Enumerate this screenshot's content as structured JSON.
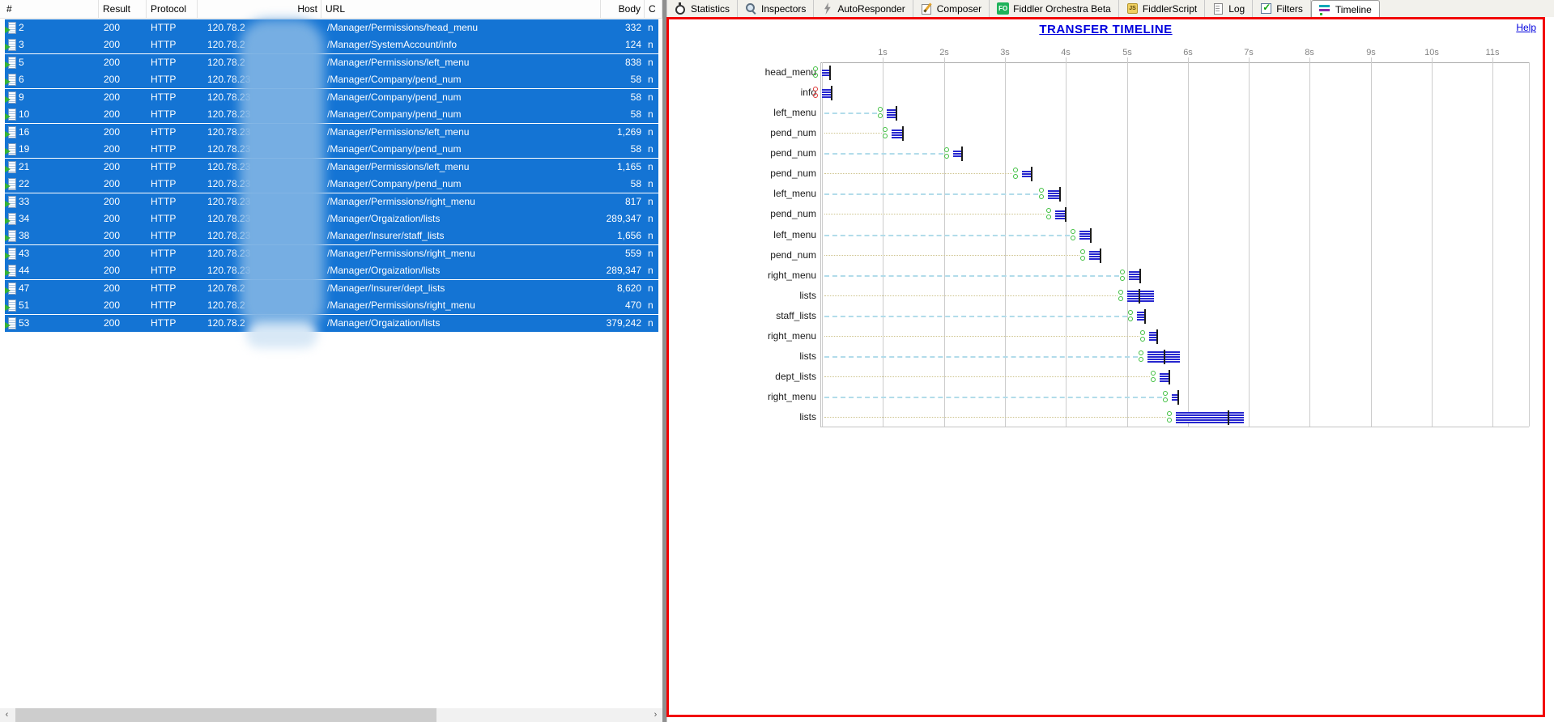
{
  "left_panel": {
    "columns": [
      {
        "label": "#"
      },
      {
        "label": "Result"
      },
      {
        "label": "Protocol"
      },
      {
        "label": "Host"
      },
      {
        "label": "URL"
      },
      {
        "label": "Body"
      },
      {
        "label": "C"
      }
    ],
    "rows": [
      {
        "id": "2",
        "result": "200",
        "protocol": "HTTP",
        "host": "120.78.2",
        "url": "/Manager/Permissions/head_menu",
        "body": "332",
        "caching": "n"
      },
      {
        "id": "3",
        "result": "200",
        "protocol": "HTTP",
        "host": "120.78.2",
        "url": "/Manager/SystemAccount/info",
        "body": "124",
        "caching": "n"
      },
      {
        "id": "5",
        "result": "200",
        "protocol": "HTTP",
        "host": "120.78.2",
        "url": "/Manager/Permissions/left_menu",
        "body": "838",
        "caching": "n"
      },
      {
        "id": "6",
        "result": "200",
        "protocol": "HTTP",
        "host": "120.78.23",
        "url": "/Manager/Company/pend_num",
        "body": "58",
        "caching": "n"
      },
      {
        "id": "9",
        "result": "200",
        "protocol": "HTTP",
        "host": "120.78.23",
        "url": "/Manager/Company/pend_num",
        "body": "58",
        "caching": "n"
      },
      {
        "id": "10",
        "result": "200",
        "protocol": "HTTP",
        "host": "120.78.23",
        "url": "/Manager/Company/pend_num",
        "body": "58",
        "caching": "n"
      },
      {
        "id": "16",
        "result": "200",
        "protocol": "HTTP",
        "host": "120.78.23",
        "url": "/Manager/Permissions/left_menu",
        "body": "1,269",
        "caching": "n"
      },
      {
        "id": "19",
        "result": "200",
        "protocol": "HTTP",
        "host": "120.78.23",
        "url": "/Manager/Company/pend_num",
        "body": "58",
        "caching": "n"
      },
      {
        "id": "21",
        "result": "200",
        "protocol": "HTTP",
        "host": "120.78.23",
        "url": "/Manager/Permissions/left_menu",
        "body": "1,165",
        "caching": "n"
      },
      {
        "id": "22",
        "result": "200",
        "protocol": "HTTP",
        "host": "120.78.23",
        "url": "/Manager/Company/pend_num",
        "body": "58",
        "caching": "n"
      },
      {
        "id": "33",
        "result": "200",
        "protocol": "HTTP",
        "host": "120.78.23",
        "url": "/Manager/Permissions/right_menu",
        "body": "817",
        "caching": "n"
      },
      {
        "id": "34",
        "result": "200",
        "protocol": "HTTP",
        "host": "120.78.23",
        "url": "/Manager/Orgaization/lists",
        "body": "289,347",
        "caching": "n"
      },
      {
        "id": "38",
        "result": "200",
        "protocol": "HTTP",
        "host": "120.78.23",
        "url": "/Manager/Insurer/staff_lists",
        "body": "1,656",
        "caching": "n"
      },
      {
        "id": "43",
        "result": "200",
        "protocol": "HTTP",
        "host": "120.78.23",
        "url": "/Manager/Permissions/right_menu",
        "body": "559",
        "caching": "n"
      },
      {
        "id": "44",
        "result": "200",
        "protocol": "HTTP",
        "host": "120.78.23",
        "url": "/Manager/Orgaization/lists",
        "body": "289,347",
        "caching": "n"
      },
      {
        "id": "47",
        "result": "200",
        "protocol": "HTTP",
        "host": "120.78.2",
        "url": "/Manager/Insurer/dept_lists",
        "body": "8,620",
        "caching": "n"
      },
      {
        "id": "51",
        "result": "200",
        "protocol": "HTTP",
        "host": "120.78.2",
        "url": "/Manager/Permissions/right_menu",
        "body": "470",
        "caching": "n"
      },
      {
        "id": "53",
        "result": "200",
        "protocol": "HTTP",
        "host": "120.78.2",
        "url": "/Manager/Orgaization/lists",
        "body": "379,242",
        "caching": "n"
      }
    ],
    "selection_color": "#1474d4"
  },
  "tabs": [
    {
      "label": "Statistics",
      "icon": "stopwatch-icon",
      "active": false
    },
    {
      "label": "Inspectors",
      "icon": "magnifier-icon",
      "active": false
    },
    {
      "label": "AutoResponder",
      "icon": "lightning-icon",
      "active": false
    },
    {
      "label": "Composer",
      "icon": "compose-icon",
      "active": false
    },
    {
      "label": "Fiddler Orchestra Beta",
      "icon": "orchestra-icon",
      "active": false
    },
    {
      "label": "FiddlerScript",
      "icon": "script-icon",
      "active": false
    },
    {
      "label": "Log",
      "icon": "log-icon",
      "active": false
    },
    {
      "label": "Filters",
      "icon": "filters-icon",
      "active": false
    },
    {
      "label": "Timeline",
      "icon": "timeline-icon",
      "active": true
    }
  ],
  "timeline": {
    "title": "TRANSFER TIMELINE",
    "help_label": "Help",
    "border_color": "#f20404",
    "title_color": "#0000dd",
    "chart_data": {
      "type": "timeline-gantt",
      "unit": "seconds",
      "axis_ticks": [
        "1s",
        "2s",
        "3s",
        "4s",
        "5s",
        "6s",
        "7s",
        "8s",
        "9s",
        "10s",
        "11s"
      ],
      "axis_range": [
        0,
        11.6
      ],
      "bar_color": "#2626cf",
      "rows": [
        {
          "label": "head_menu",
          "start": 0.0,
          "end": 0.12,
          "tick": 0.12,
          "leader": "none",
          "marker": "green",
          "stripes": 3
        },
        {
          "label": "info",
          "start": 0.0,
          "end": 0.15,
          "tick": 0.15,
          "leader": "none",
          "marker": "red",
          "stripes": 4
        },
        {
          "label": "left_menu",
          "start": 1.06,
          "end": 1.21,
          "tick": 1.21,
          "leader": "cyan",
          "marker": "green",
          "stripes": 4
        },
        {
          "label": "pend_num",
          "start": 1.14,
          "end": 1.31,
          "tick": 1.31,
          "leader": "tan",
          "marker": "green",
          "stripes": 4
        },
        {
          "label": "pend_num",
          "start": 2.15,
          "end": 2.29,
          "tick": 2.29,
          "leader": "cyan",
          "marker": "green",
          "stripes": 3
        },
        {
          "label": "pend_num",
          "start": 3.28,
          "end": 3.42,
          "tick": 3.42,
          "leader": "tan",
          "marker": "green",
          "stripes": 3
        },
        {
          "label": "left_menu",
          "start": 3.71,
          "end": 3.89,
          "tick": 3.89,
          "leader": "cyan",
          "marker": "green",
          "stripes": 4
        },
        {
          "label": "pend_num",
          "start": 3.82,
          "end": 3.99,
          "tick": 3.99,
          "leader": "tan",
          "marker": "green",
          "stripes": 4
        },
        {
          "label": "left_menu",
          "start": 4.22,
          "end": 4.39,
          "tick": 4.39,
          "leader": "cyan",
          "marker": "green",
          "stripes": 4
        },
        {
          "label": "pend_num",
          "start": 4.38,
          "end": 4.55,
          "tick": 4.55,
          "leader": "tan",
          "marker": "green",
          "stripes": 4
        },
        {
          "label": "right_menu",
          "start": 5.03,
          "end": 5.21,
          "tick": 5.21,
          "leader": "cyan",
          "marker": "green",
          "stripes": 4
        },
        {
          "label": "lists",
          "start": 5.01,
          "end": 5.44,
          "tick": 5.19,
          "leader": "tan",
          "marker": "green",
          "stripes": 5
        },
        {
          "label": "staff_lists",
          "start": 5.17,
          "end": 5.29,
          "tick": 5.29,
          "leader": "cyan",
          "marker": "green",
          "stripes": 4
        },
        {
          "label": "right_menu",
          "start": 5.37,
          "end": 5.49,
          "tick": 5.49,
          "leader": "tan",
          "marker": "green",
          "stripes": 4
        },
        {
          "label": "lists",
          "start": 5.34,
          "end": 5.87,
          "tick": 5.6,
          "leader": "cyan",
          "marker": "green",
          "stripes": 5
        },
        {
          "label": "dept_lists",
          "start": 5.54,
          "end": 5.68,
          "tick": 5.68,
          "leader": "tan",
          "marker": "green",
          "stripes": 4
        },
        {
          "label": "right_menu",
          "start": 5.74,
          "end": 5.83,
          "tick": 5.83,
          "leader": "cyan",
          "marker": "green",
          "stripes": 3
        },
        {
          "label": "lists",
          "start": 5.8,
          "end": 6.92,
          "tick": 6.66,
          "leader": "tan",
          "marker": "green",
          "stripes": 5
        }
      ]
    }
  }
}
